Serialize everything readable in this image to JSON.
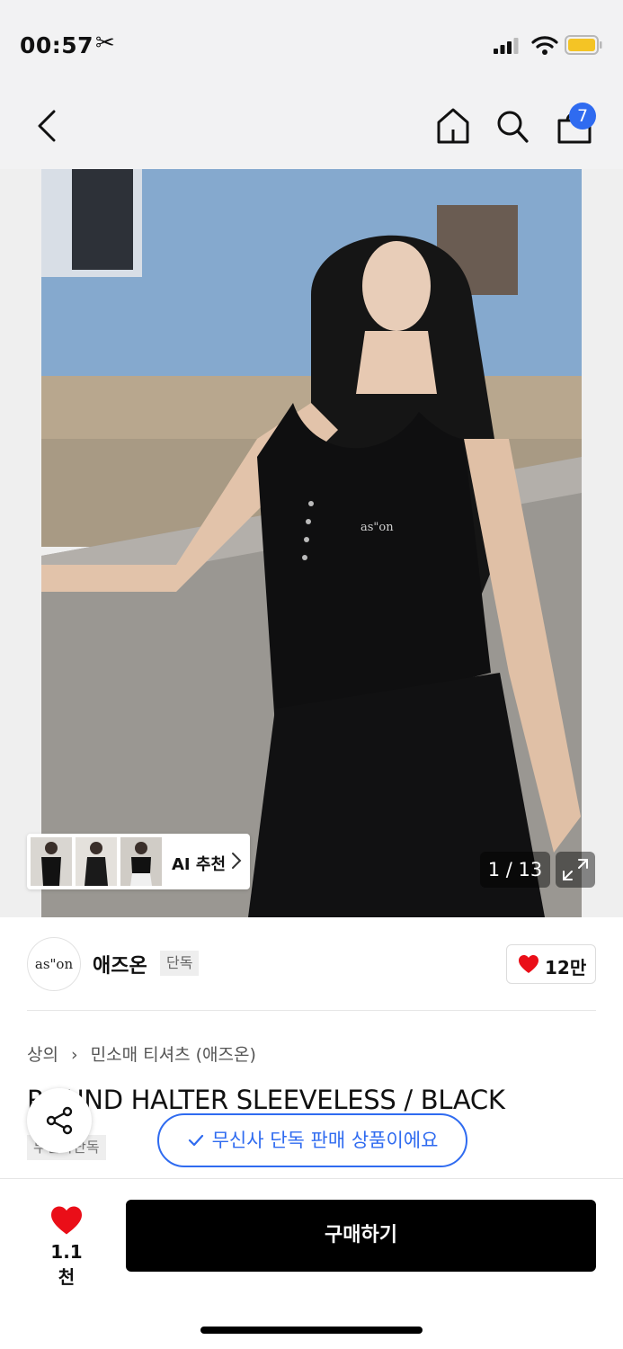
{
  "status_bar": {
    "time": "00:57"
  },
  "header": {
    "cart_count": "7"
  },
  "gallery": {
    "counter": "1 / 13",
    "ai_recommend_label": "AI 추천",
    "print_on_top": "as\"on"
  },
  "brand": {
    "logo_text": "as\"on",
    "name": "애즈온",
    "tag": "단독",
    "likes": "12만"
  },
  "product": {
    "breadcrumb": [
      "상의",
      "민소매 티셔츠 (애즈온)"
    ],
    "title": "ROUND HALTER SLEEVELESS / BLACK",
    "exclusive_tag": "무신사단독"
  },
  "toast": {
    "text": "무신사 단독 판매 상품이에요"
  },
  "bottom_bar": {
    "favorite_count": "1.1천",
    "buy_label": "구매하기"
  },
  "colors": {
    "accent_blue": "#2f6bf0",
    "heart_red": "#ea0e18",
    "battery_yellow": "#f4c425"
  }
}
